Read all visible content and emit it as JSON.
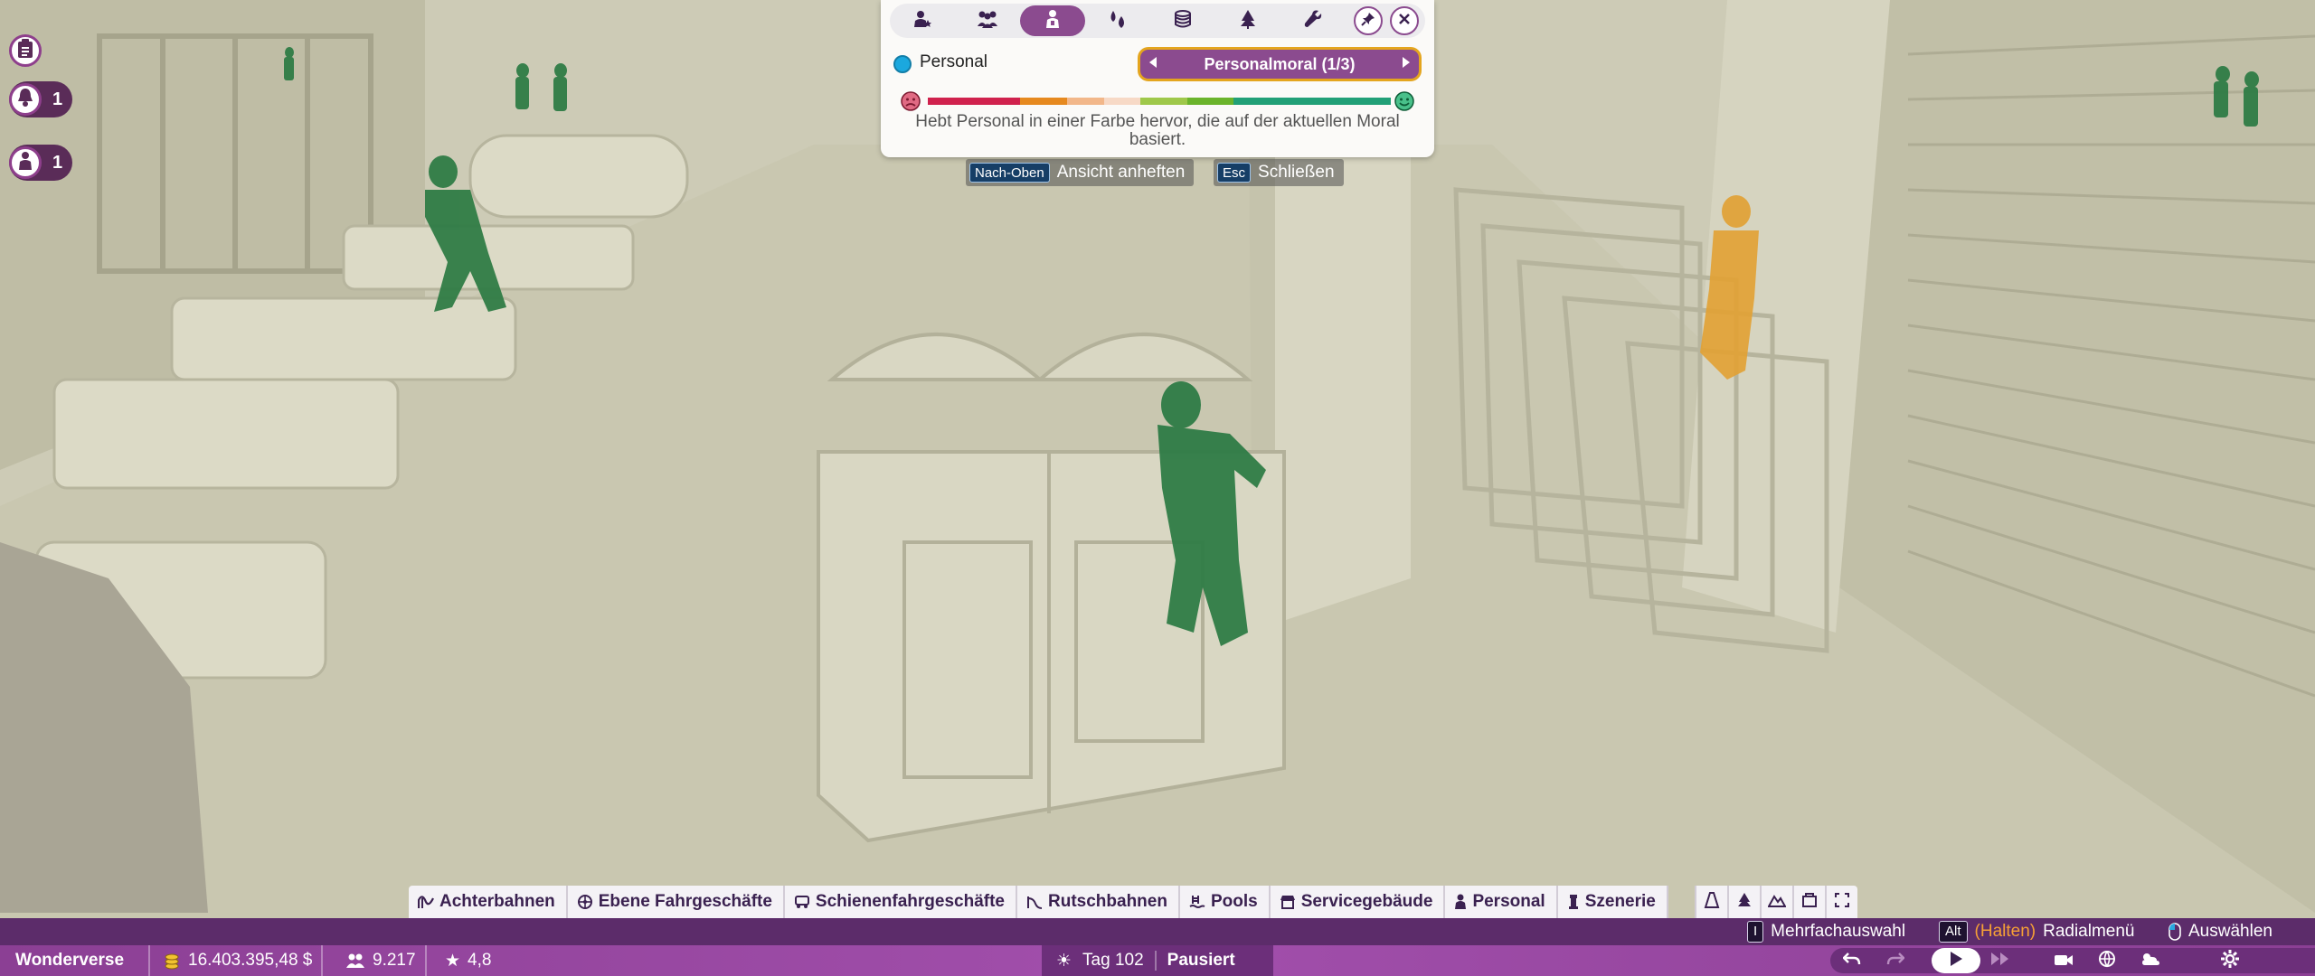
{
  "left_badges": {
    "clipboard_icon": "clipboard-icon",
    "notifications_count": "1",
    "staff_alerts_count": "1"
  },
  "overlay": {
    "toolbar_icons": [
      "guest-star-icon",
      "guests-group-icon",
      "staff-icon",
      "needs-drops-icon",
      "stacked-coins-icon",
      "tree-scenery-icon",
      "wrench-icon"
    ],
    "active_tool_index": 2,
    "layer_name": "Personal",
    "layer_color": "#1ba8de",
    "selector_label": "Personalmoral (1/3)",
    "scale_colors": [
      "#d0214d",
      "#e6891f",
      "#f2b78a",
      "#f7d9c6",
      "#9fc84a",
      "#6bb42b",
      "#22a077"
    ],
    "description": "Hebt Personal in einer Farbe hervor, die auf der aktuellen Moral basiert."
  },
  "hints": [
    {
      "key": "Nach-Oben",
      "label": "Ansicht anheften"
    },
    {
      "key": "Esc",
      "label": "Schließen"
    }
  ],
  "categories": [
    {
      "label": "Achterbahnen",
      "icon": "coaster-icon"
    },
    {
      "label": "Ebene Fahrgeschäfte",
      "icon": "flat-ride-icon"
    },
    {
      "label": "Schienenfahrgeschäfte",
      "icon": "track-ride-icon"
    },
    {
      "label": "Rutschbahnen",
      "icon": "slide-icon"
    },
    {
      "label": "Pools",
      "icon": "pool-icon"
    },
    {
      "label": "Servicegebäude",
      "icon": "service-building-icon"
    },
    {
      "label": "Personal",
      "icon": "staff-icon"
    },
    {
      "label": "Szenerie",
      "icon": "scenery-icon"
    }
  ],
  "category_tool_icons": [
    "paths-icon",
    "trees-icon",
    "terrain-icon",
    "blueprint-icon",
    "expand-icon"
  ],
  "controls": {
    "multi_key": "I",
    "multi_label": "Mehrfachauswahl",
    "alt_key": "Alt",
    "hold_label": "(Halten)",
    "radial_label": "Radialmenü",
    "select_label": "Auswählen"
  },
  "status": {
    "park_name": "Wonderverse",
    "money": "16.403.395,48 $",
    "guests": "9.217",
    "rating": "4,8",
    "day": "Tag 102",
    "state": "Pausiert"
  }
}
